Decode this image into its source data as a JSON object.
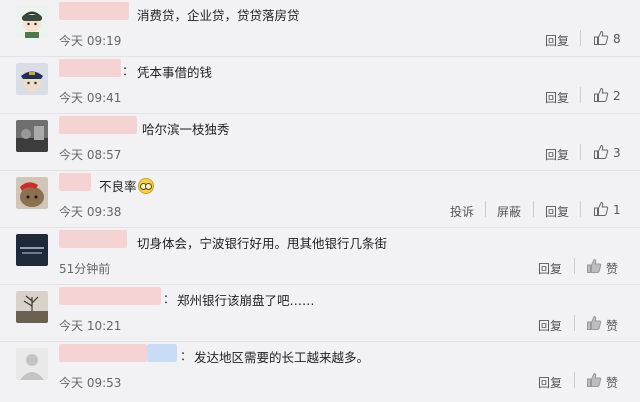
{
  "comments": [
    {
      "time": "今天 09:19",
      "text": "消费贷，企业贷，贷贷落房贷",
      "colon": "",
      "reply": "回复",
      "likes": "8"
    },
    {
      "time": "今天 09:41",
      "text": "凭本事借的钱",
      "colon": "：",
      "reply": "回复",
      "likes": "2"
    },
    {
      "time": "今天 08:57",
      "text": "哈尔滨一枝独秀",
      "colon": "",
      "reply": "回复",
      "likes": "3"
    },
    {
      "time": "今天 09:38",
      "text": "不良率",
      "colon": "",
      "report": "投诉",
      "block": "屏蔽",
      "reply": "回复",
      "likes": "1"
    },
    {
      "time": "51分钟前",
      "text": "切身体会，宁波银行好用。甩其他银行几条街",
      "colon": "",
      "reply": "回复",
      "zan": "赞"
    },
    {
      "time": "今天 10:21",
      "text": "郑州银行该崩盘了吧……",
      "colon": "：",
      "reply": "回复",
      "zan": "赞"
    },
    {
      "time": "今天 09:53",
      "text": "发达地区需要的长工越来越多。",
      "colon": "：",
      "reply": "回复",
      "zan": "赞"
    }
  ],
  "colors": {
    "background": "#f2f2f5",
    "masked_name": "#f6d3d3",
    "masked_name_blue": "#c9dcf5"
  }
}
